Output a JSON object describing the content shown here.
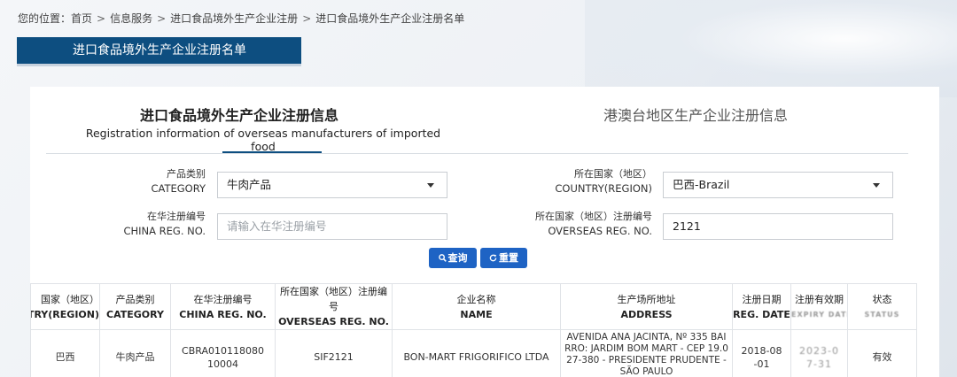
{
  "breadcrumb": {
    "prefix": "您的位置：",
    "items": [
      "首页",
      "信息服务",
      "进口食品境外生产企业注册",
      "进口食品境外生产企业注册名单"
    ],
    "separator": ">"
  },
  "page_title": "进口食品境外生产企业注册名单",
  "tabs": {
    "active": {
      "title_cn": "进口食品境外生产企业注册信息",
      "title_en": "Registration information of overseas manufacturers of imported food"
    },
    "inactive": {
      "title_cn": "港澳台地区生产企业注册信息"
    }
  },
  "form": {
    "category": {
      "label_cn": "产品类别",
      "label_en": "CATEGORY",
      "value": "牛肉产品"
    },
    "country": {
      "label_cn": "所在国家（地区）",
      "label_en": "COUNTRY(REGION)",
      "value": "巴西-Brazil"
    },
    "china_reg": {
      "label_cn": "在华注册编号",
      "label_en": "CHINA REG. NO.",
      "placeholder": "请输入在华注册编号"
    },
    "overseas_reg": {
      "label_cn": "所在国家（地区）注册编号",
      "label_en": "OVERSEAS REG. NO.",
      "value": "2121"
    },
    "search_button": "查询",
    "reset_button": "重置"
  },
  "table": {
    "headers": [
      {
        "cn": "国家（地区）",
        "en": "COUNTRY(REGION)"
      },
      {
        "cn": "产品类别",
        "en": "CATEGORY"
      },
      {
        "cn": "在华注册编号",
        "en": "CHINA REG. NO."
      },
      {
        "cn": "所在国家（地区）注册编号",
        "en": "OVERSEAS REG. NO."
      },
      {
        "cn": "企业名称",
        "en": "NAME"
      },
      {
        "cn": "生产场所地址",
        "en": "ADDRESS"
      },
      {
        "cn": "注册日期",
        "en": "REG. DATE"
      },
      {
        "cn": "注册有效期",
        "en": "EXPIRY DATE"
      },
      {
        "cn": "状态",
        "en": "STATUS"
      }
    ],
    "rows": [
      {
        "country": "巴西",
        "category": "牛肉产品",
        "china_reg": "CBRA01011808010004",
        "overseas_reg": "SIF2121",
        "name": "BON-MART FRIGORIFICO LTDA",
        "address": "AVENIDA ANA JACINTA, Nº 335 BAIRRO: JARDIM BOM MART - CEP 19.027-380 - PRESIDENTE PRUDENTE - SÃO PAULO",
        "reg_date": "2018-08-01",
        "expiry": "2023-07-31",
        "status": "有效"
      }
    ]
  },
  "colors": {
    "primary": "#0d4e80",
    "button": "#1e63c4"
  },
  "icons": {
    "search": "search-icon",
    "reset": "refresh-icon",
    "dropdown": "chevron-down-icon"
  }
}
